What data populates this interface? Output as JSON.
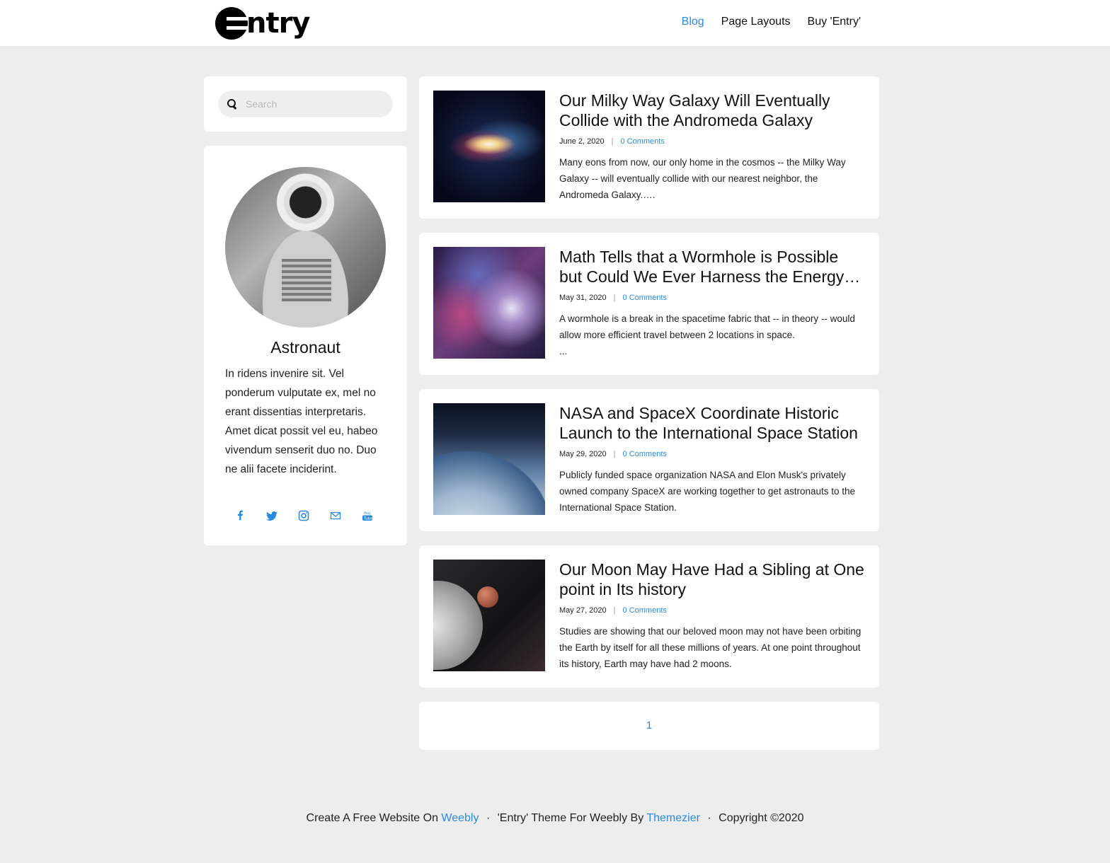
{
  "header": {
    "logo_text": "ntry",
    "nav": [
      {
        "label": "Blog",
        "active": true
      },
      {
        "label": "Page Layouts",
        "active": false
      },
      {
        "label": "Buy 'Entry'",
        "active": false
      }
    ]
  },
  "sidebar": {
    "search": {
      "placeholder": "Search",
      "icon": "search-icon"
    },
    "profile": {
      "name": "Astronaut",
      "bio": "In ridens invenire sit. Vel ponderum vulputate ex, mel no erant dissentias interpretaris. Amet dicat possit vel eu, habeo vivendum senserit duo no. Duo ne alii facete inciderint.",
      "socials": [
        "facebook-icon",
        "twitter-icon",
        "instagram-icon",
        "mail-icon",
        "youtube-icon"
      ]
    }
  },
  "posts": [
    {
      "title": "Our Milky Way Galaxy Will Eventually Collide with the Andromeda Galaxy",
      "date": "June 2, 2020",
      "comments": "0 Comments",
      "excerpt": "Many eons from now, our only home in the cosmos -- the Milky Way Galaxy -- will eventually collide with our nearest neighbor, the Andromeda Galaxy.…."
    },
    {
      "title": "Math Tells that a Wormhole is Possible but Could We Ever Harness the Energy t…",
      "date": "May 31, 2020",
      "comments": "0 Comments",
      "excerpt": "A wormhole is a break in the spacetime fabric that -- in theory -- would allow more efficient travel between 2 locations in space.",
      "excerpt_more": "..."
    },
    {
      "title": "NASA and SpaceX Coordinate Historic Launch to the International Space Station",
      "date": "May 29, 2020",
      "comments": "0 Comments",
      "excerpt": "Publicly funded space organization NASA and Elon Musk's privately owned company SpaceX are working together to get astronauts to the International Space Station."
    },
    {
      "title": "Our Moon May Have Had a Sibling at One point in Its history",
      "date": "May 27, 2020",
      "comments": "0 Comments",
      "excerpt": "Studies are showing that our beloved moon may not have been orbiting the Earth by itself for all these millions of years. At one point throughout its history, Earth may have had 2 moons."
    }
  ],
  "pagination": {
    "current": "1"
  },
  "footer": {
    "part1": "Create A Free Website On ",
    "link1": "Weebly",
    "sep": "·",
    "part2": "'Entry' Theme For Weebly By ",
    "link2": "Themezier",
    "part3": "Copyright ©2020"
  },
  "colors": {
    "accent": "#2a8ae0",
    "background": "#ededed",
    "card": "#ffffff"
  }
}
